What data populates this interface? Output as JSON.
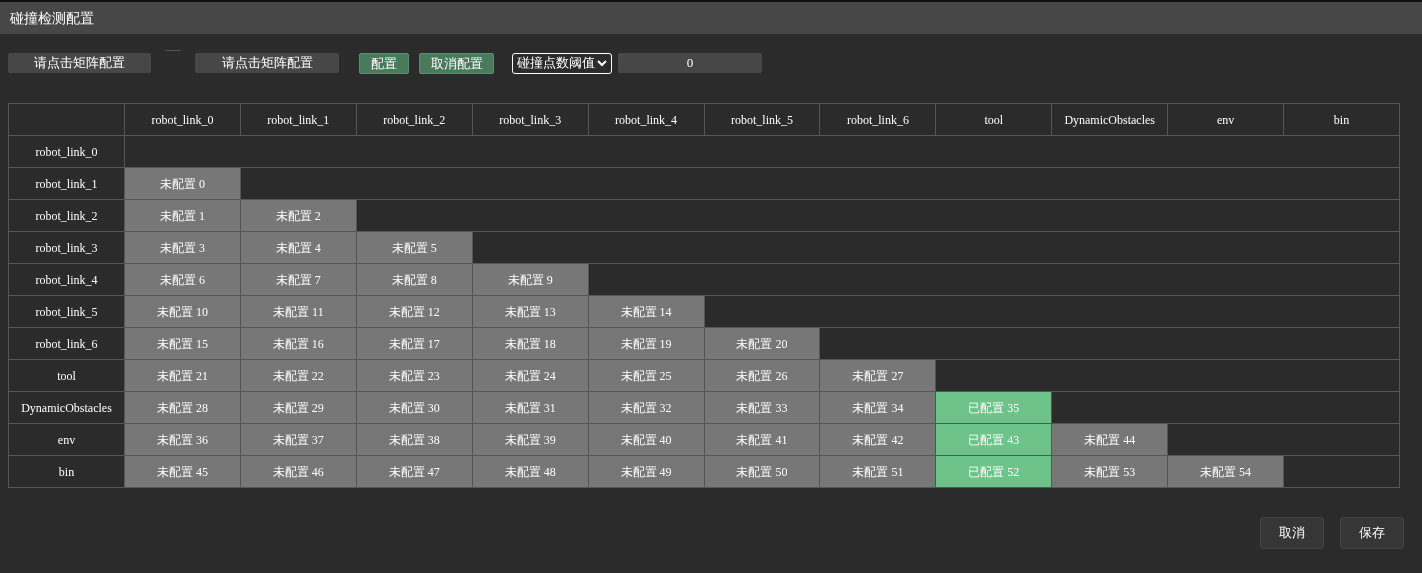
{
  "window": {
    "title": "碰撞检测配置"
  },
  "toolbar": {
    "pick_a": "请点击矩阵配置",
    "pick_b": "请点击矩阵配置",
    "configure": "配置",
    "unconfigure": "取消配置",
    "threshold_select": "碰撞点数阈值",
    "threshold_value": "0"
  },
  "matrix": {
    "columns": [
      "robot_link_0",
      "robot_link_1",
      "robot_link_2",
      "robot_link_3",
      "robot_link_4",
      "robot_link_5",
      "robot_link_6",
      "tool",
      "DynamicObstacles",
      "env",
      "bin"
    ],
    "rows": [
      {
        "label": "robot_link_0",
        "cells": []
      },
      {
        "label": "robot_link_1",
        "cells": [
          {
            "text": "未配置 0",
            "configured": false
          }
        ]
      },
      {
        "label": "robot_link_2",
        "cells": [
          {
            "text": "未配置 1",
            "configured": false
          },
          {
            "text": "未配置 2",
            "configured": false
          }
        ]
      },
      {
        "label": "robot_link_3",
        "cells": [
          {
            "text": "未配置 3",
            "configured": false
          },
          {
            "text": "未配置 4",
            "configured": false
          },
          {
            "text": "未配置 5",
            "configured": false
          }
        ]
      },
      {
        "label": "robot_link_4",
        "cells": [
          {
            "text": "未配置 6",
            "configured": false
          },
          {
            "text": "未配置 7",
            "configured": false
          },
          {
            "text": "未配置 8",
            "configured": false
          },
          {
            "text": "未配置 9",
            "configured": false
          }
        ]
      },
      {
        "label": "robot_link_5",
        "cells": [
          {
            "text": "未配置 10",
            "configured": false
          },
          {
            "text": "未配置 11",
            "configured": false
          },
          {
            "text": "未配置 12",
            "configured": false
          },
          {
            "text": "未配置 13",
            "configured": false
          },
          {
            "text": "未配置 14",
            "configured": false
          }
        ]
      },
      {
        "label": "robot_link_6",
        "cells": [
          {
            "text": "未配置 15",
            "configured": false
          },
          {
            "text": "未配置 16",
            "configured": false
          },
          {
            "text": "未配置 17",
            "configured": false
          },
          {
            "text": "未配置 18",
            "configured": false
          },
          {
            "text": "未配置 19",
            "configured": false
          },
          {
            "text": "未配置 20",
            "configured": false
          }
        ]
      },
      {
        "label": "tool",
        "cells": [
          {
            "text": "未配置 21",
            "configured": false
          },
          {
            "text": "未配置 22",
            "configured": false
          },
          {
            "text": "未配置 23",
            "configured": false
          },
          {
            "text": "未配置 24",
            "configured": false
          },
          {
            "text": "未配置 25",
            "configured": false
          },
          {
            "text": "未配置 26",
            "configured": false
          },
          {
            "text": "未配置 27",
            "configured": false
          }
        ]
      },
      {
        "label": "DynamicObstacles",
        "cells": [
          {
            "text": "未配置 28",
            "configured": false
          },
          {
            "text": "未配置 29",
            "configured": false
          },
          {
            "text": "未配置 30",
            "configured": false
          },
          {
            "text": "未配置 31",
            "configured": false
          },
          {
            "text": "未配置 32",
            "configured": false
          },
          {
            "text": "未配置 33",
            "configured": false
          },
          {
            "text": "未配置 34",
            "configured": false
          },
          {
            "text": "已配置 35",
            "configured": true
          }
        ]
      },
      {
        "label": "env",
        "cells": [
          {
            "text": "未配置 36",
            "configured": false
          },
          {
            "text": "未配置 37",
            "configured": false
          },
          {
            "text": "未配置 38",
            "configured": false
          },
          {
            "text": "未配置 39",
            "configured": false
          },
          {
            "text": "未配置 40",
            "configured": false
          },
          {
            "text": "未配置 41",
            "configured": false
          },
          {
            "text": "未配置 42",
            "configured": false
          },
          {
            "text": "已配置 43",
            "configured": true
          },
          {
            "text": "未配置 44",
            "configured": false
          }
        ]
      },
      {
        "label": "bin",
        "cells": [
          {
            "text": "未配置 45",
            "configured": false
          },
          {
            "text": "未配置 46",
            "configured": false
          },
          {
            "text": "未配置 47",
            "configured": false
          },
          {
            "text": "未配置 48",
            "configured": false
          },
          {
            "text": "未配置 49",
            "configured": false
          },
          {
            "text": "未配置 50",
            "configured": false
          },
          {
            "text": "未配置 51",
            "configured": false
          },
          {
            "text": "已配置 52",
            "configured": true
          },
          {
            "text": "未配置 53",
            "configured": false
          },
          {
            "text": "未配置 54",
            "configured": false
          }
        ]
      }
    ]
  },
  "footer": {
    "cancel": "取消",
    "save": "保存"
  }
}
